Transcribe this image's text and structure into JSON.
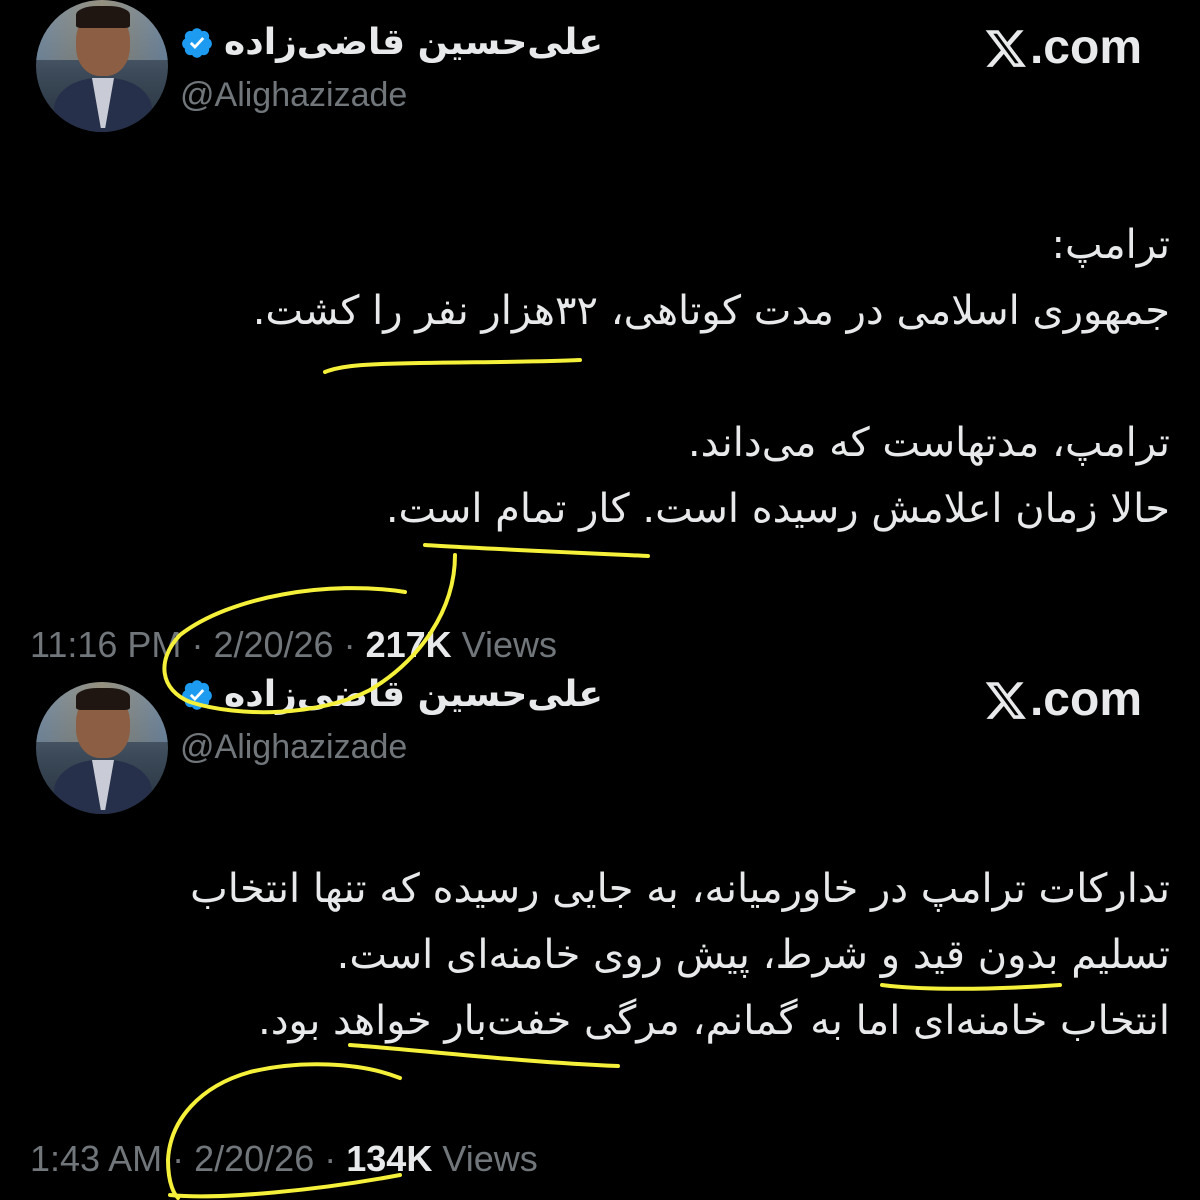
{
  "tweets": [
    {
      "author_name": "علی‌حسین قاضی‌زاده",
      "handle": "@Alighazizade",
      "brand": ".com",
      "lines": [
        "ترامپ:",
        "جمهوری اسلامی در مدت کوتاهی، ۳۲هزار نفر را کشت.",
        "",
        "ترامپ، مدتهاست که می‌داند.",
        "حالا زمان اعلامش رسیده است. کار تمام است."
      ],
      "time": "11:16 PM",
      "date": "2/20/26",
      "views_count": "217K",
      "views_label": "Views"
    },
    {
      "author_name": "علی‌حسین قاضی‌زاده",
      "handle": "@Alighazizade",
      "brand": ".com",
      "lines": [
        "تدارکات ترامپ در خاورمیانه، به جایی رسیده که تنها انتخاب",
        "تسلیم بدون قید و شرط، پیش روی خامنه‌ای است.",
        "انتخاب خامنه‌ای اما به گمانم، مرگی خفت‌بار خواهد بود."
      ],
      "time": "1:43 AM",
      "date": "2/20/26",
      "views_count": "134K",
      "views_label": "Views"
    }
  ],
  "colors": {
    "background": "#000000",
    "text": "#e7e9ea",
    "muted": "#71767b",
    "verified": "#1d9bf0",
    "annotation": "#f5f03a"
  },
  "icons": [
    "verified-badge-icon",
    "x-logo-icon"
  ]
}
